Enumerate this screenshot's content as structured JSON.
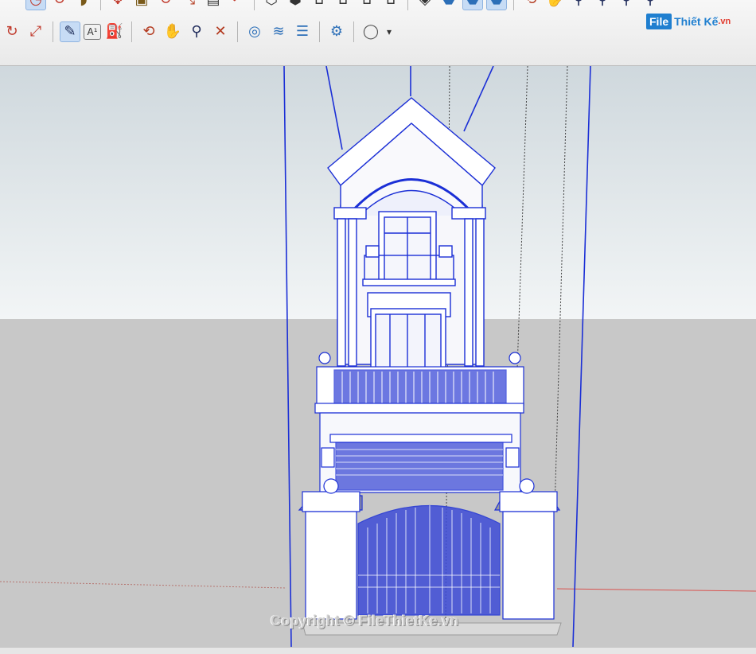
{
  "toolbar_row1": {
    "icons": [
      "arc-icon",
      "pie-icon",
      "move-icon",
      "pushpull-icon",
      "rotate-icon",
      "followme-icon",
      "scale-icon",
      "offset-icon",
      "warehouse-icon",
      "home-view-icon",
      "house-front-icon",
      "house-side-icon",
      "house-top-icon",
      "xray-icon",
      "back-edges-icon",
      "wireframe-icon",
      "shaded-icon",
      "orbit-icon",
      "pan-icon",
      "zoom-icon",
      "zoom-window-icon",
      "zoom-extents-icon",
      "section-icon"
    ]
  },
  "toolbar_row2": {
    "tools": [
      {
        "name": "rotate-tool-icon",
        "glyph": "↻",
        "color": "#c0392b"
      },
      {
        "name": "scale-tool-icon",
        "glyph": "⤢",
        "color": "#c0392b"
      },
      {
        "name": "tape-measure-icon",
        "glyph": "✎",
        "color": "#1c2b57",
        "active": true
      },
      {
        "name": "text-label-icon",
        "glyph": "A¹",
        "color": "#333333"
      },
      {
        "name": "paint-bucket-icon",
        "glyph": "⛽",
        "color": "#7a5a1a"
      },
      {
        "name": "orbit-icon",
        "glyph": "⟲",
        "color": "#b33a1f"
      },
      {
        "name": "pan-hand-icon",
        "glyph": "✋",
        "color": "#c98b3d"
      },
      {
        "name": "zoom-icon",
        "glyph": "⚲",
        "color": "#1e2a5a"
      },
      {
        "name": "zoom-extents-icon",
        "glyph": "✕",
        "color": "#b33a1f"
      },
      {
        "name": "geolocation-icon",
        "glyph": "◎",
        "color": "#2c6fb8"
      },
      {
        "name": "terrain-icon",
        "glyph": "≋",
        "color": "#2c6fb8"
      },
      {
        "name": "layers-icon",
        "glyph": "☰",
        "color": "#2c6fb8"
      },
      {
        "name": "sandbox-icon",
        "glyph": "⚙",
        "color": "#2c6fb8"
      },
      {
        "name": "account-icon",
        "glyph": "◯",
        "color": "#555555"
      }
    ],
    "dropdown": "▾"
  },
  "logo": {
    "brand": "File",
    "text": "Thiết Kế",
    "suffix": ".vn"
  },
  "watermark": "Copyright © FileThietKe.vn",
  "colors": {
    "edge": "#1b2fd6",
    "axis_red": "#d9534f",
    "ground": "#c8c8c8",
    "sky_top": "#cfd8dd",
    "sky_bottom": "#f2f5f6"
  }
}
